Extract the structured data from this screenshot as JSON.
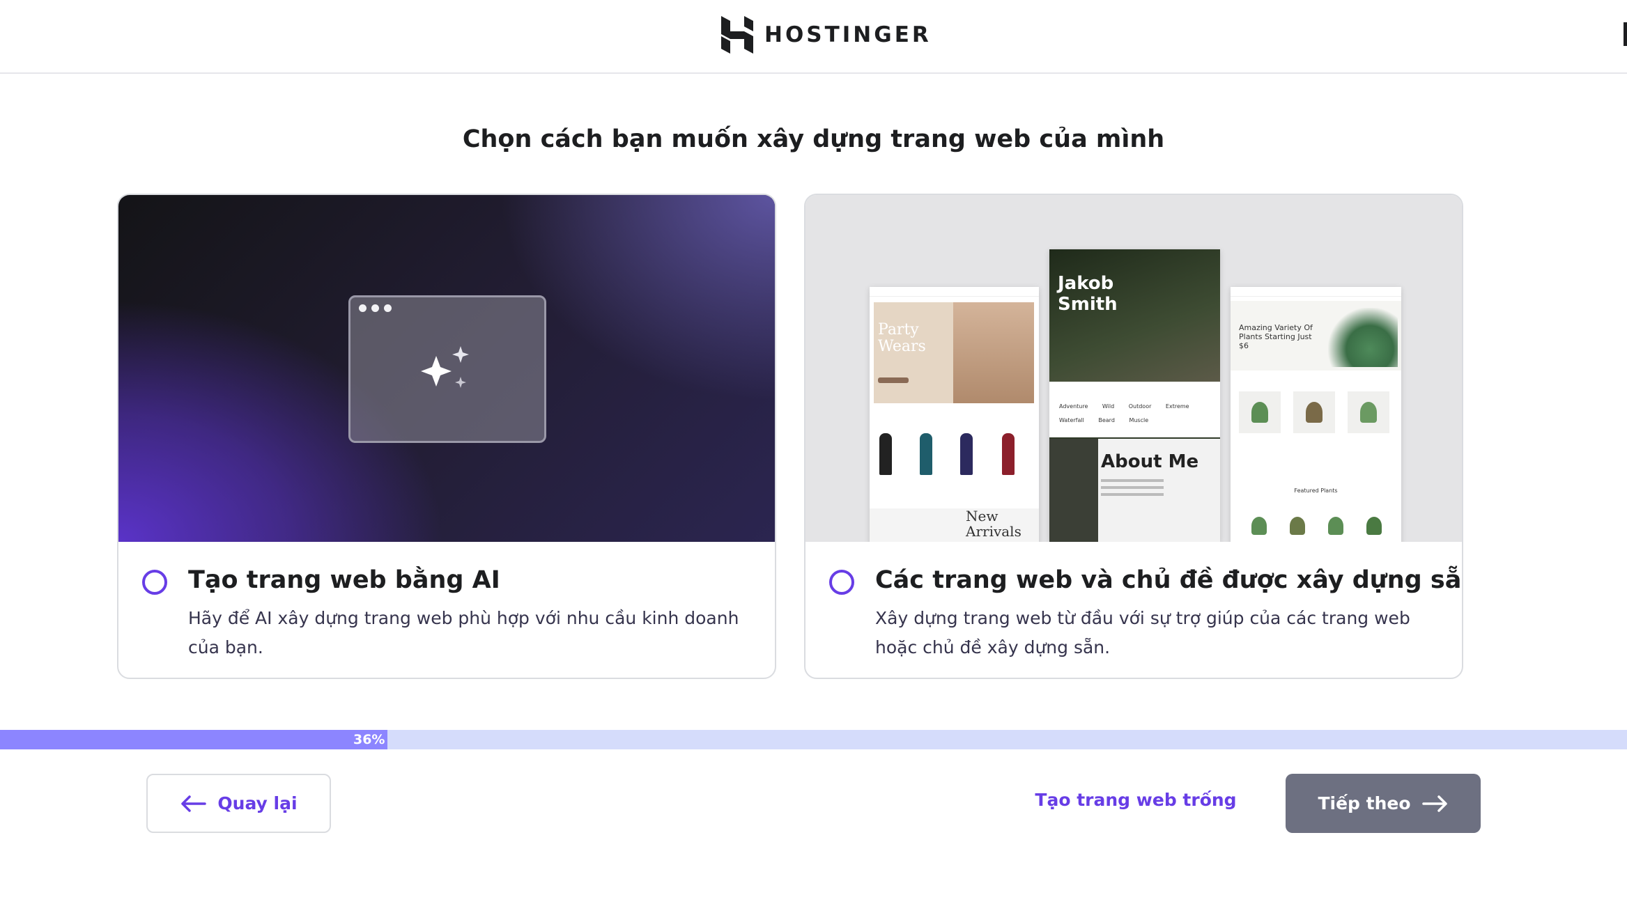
{
  "header": {
    "brand": "HOSTINGER",
    "logo_icon": "hostinger-logo-icon"
  },
  "page": {
    "title": "Chọn cách bạn muốn xây dựng trang web của mình"
  },
  "options": [
    {
      "title": "Tạo trang web bằng AI",
      "description": "Hãy để AI xây dựng trang web phù hợp với nhu cầu kinh doanh của bạn.",
      "selected": false,
      "icon": "sparkles-icon"
    },
    {
      "title": "Các trang web và chủ đề được xây dựng sẵn",
      "description": "Xây dựng trang web từ đầu với sự trợ giúp của các trang web hoặc chủ đề xây dựng sẵn.",
      "selected": false,
      "preview": {
        "fashion": {
          "headline": "Party Wears",
          "sub": "New Arrivals"
        },
        "personal": {
          "headline": "Jakob Smith",
          "about": "About Me",
          "tags": [
            "Adventure",
            "Wild",
            "Outdoor",
            "Extreme",
            "Waterfall",
            "Beard",
            "Muscle"
          ]
        },
        "plants": {
          "headline": "Amazing Variety Of Plants Starting Just $6",
          "section": "Featured Plants"
        }
      }
    }
  ],
  "progress": {
    "percent": 36,
    "label": "36%"
  },
  "footer": {
    "back_label": "Quay lại",
    "blank_label": "Tạo trang web trống",
    "next_label": "Tiếp theo"
  },
  "colors": {
    "accent": "#673de6",
    "progress_fill": "#8c85ff",
    "progress_track": "#d5dcfb",
    "next_button": "#6d7081"
  }
}
